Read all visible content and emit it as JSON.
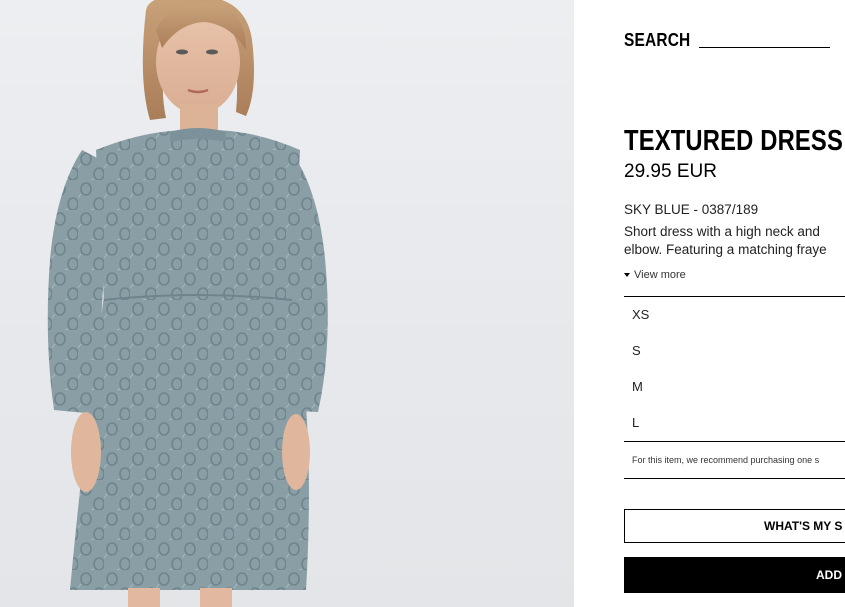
{
  "search": {
    "label": "SEARCH"
  },
  "product": {
    "image_alt": "model-wearing-textured-dress",
    "title": "TEXTURED DRESS",
    "price": "29.95 EUR",
    "color_ref": "SKY BLUE - 0387/189",
    "description": "Short dress with a high neck and \nelbow. Featuring a matching fraye",
    "view_more": "View more",
    "accent_color": "#8fa3aa"
  },
  "sizes": [
    {
      "label": "XS"
    },
    {
      "label": "S"
    },
    {
      "label": "M"
    },
    {
      "label": "L"
    }
  ],
  "size_recommendation": "For this item, we recommend purchasing one s",
  "actions": {
    "whats_my_size": "WHAT'S MY S",
    "add": "ADD"
  }
}
